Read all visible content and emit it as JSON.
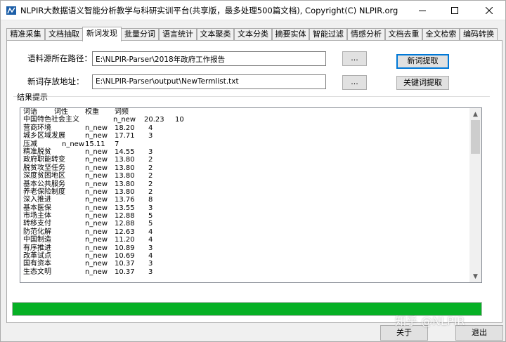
{
  "window": {
    "title": "NLPIR大数据语义智能分析教学与科研实训平台(共享版，最多处理500篇文档), Copyright(C) NLPIR.org"
  },
  "tabs": [
    {
      "label": "精准采集"
    },
    {
      "label": "文档抽取"
    },
    {
      "label": "新词发现"
    },
    {
      "label": "批量分词"
    },
    {
      "label": "语言统计"
    },
    {
      "label": "文本聚类"
    },
    {
      "label": "文本分类"
    },
    {
      "label": "摘要实体"
    },
    {
      "label": "智能过滤"
    },
    {
      "label": "情感分析"
    },
    {
      "label": "文档去重"
    },
    {
      "label": "全文检索"
    },
    {
      "label": "编码转换"
    }
  ],
  "active_tab": "新词发现",
  "form": {
    "corpus_label": "语料源所在路径：",
    "corpus_value": "E:\\NLPIR-Parser\\2018年政府工作报告",
    "output_label": "新词存放地址：",
    "output_value": "E:\\NLPIR-Parser\\output\\NewTermlist.txt",
    "browse_label": "...",
    "extract_button": "新词提取",
    "keyword_button": "关键词提取"
  },
  "results": {
    "group_label": "结果提示",
    "header": {
      "word": "词语",
      "pos": "词性",
      "weight": "权重",
      "freq": "词频"
    },
    "rows": [
      {
        "word": "中国特色社会主义",
        "pos": "n_new",
        "weight": "20.23",
        "freq": "10"
      },
      {
        "word": "营商环境",
        "pos": "n_new",
        "weight": "18.20",
        "freq": "4"
      },
      {
        "word": "城乡区域发展",
        "pos": "n_new",
        "weight": "17.71",
        "freq": "3"
      },
      {
        "word": "压减",
        "pos": "n_new",
        "weight": "15.11",
        "freq": "7"
      },
      {
        "word": "精准脱贫",
        "pos": "n_new",
        "weight": "14.55",
        "freq": "3"
      },
      {
        "word": "政府职能转变",
        "pos": "n_new",
        "weight": "13.80",
        "freq": "2"
      },
      {
        "word": "脱贫攻坚任务",
        "pos": "n_new",
        "weight": "13.80",
        "freq": "2"
      },
      {
        "word": "深度贫困地区",
        "pos": "n_new",
        "weight": "13.80",
        "freq": "2"
      },
      {
        "word": "基本公共服务",
        "pos": "n_new",
        "weight": "13.80",
        "freq": "2"
      },
      {
        "word": "养老保险制度",
        "pos": "n_new",
        "weight": "13.80",
        "freq": "2"
      },
      {
        "word": "深入推进",
        "pos": "n_new",
        "weight": "13.76",
        "freq": "8"
      },
      {
        "word": "基本医保",
        "pos": "n_new",
        "weight": "13.55",
        "freq": "3"
      },
      {
        "word": "市场主体",
        "pos": "n_new",
        "weight": "12.88",
        "freq": "5"
      },
      {
        "word": "转移支付",
        "pos": "n_new",
        "weight": "12.88",
        "freq": "5"
      },
      {
        "word": "防范化解",
        "pos": "n_new",
        "weight": "12.63",
        "freq": "4"
      },
      {
        "word": "中国制造",
        "pos": "n_new",
        "weight": "11.20",
        "freq": "4"
      },
      {
        "word": "有序推进",
        "pos": "n_new",
        "weight": "10.89",
        "freq": "3"
      },
      {
        "word": "改革试点",
        "pos": "n_new",
        "weight": "10.69",
        "freq": "4"
      },
      {
        "word": "国有资本",
        "pos": "n_new",
        "weight": "10.37",
        "freq": "3"
      },
      {
        "word": "生态文明",
        "pos": "n_new",
        "weight": "10.37",
        "freq": "3"
      }
    ]
  },
  "progress": {
    "value": 1.0,
    "color": "#06b025"
  },
  "bottom": {
    "about_button": "关于",
    "exit_button": "退出",
    "watermark": "知乎 @NLPIR"
  }
}
